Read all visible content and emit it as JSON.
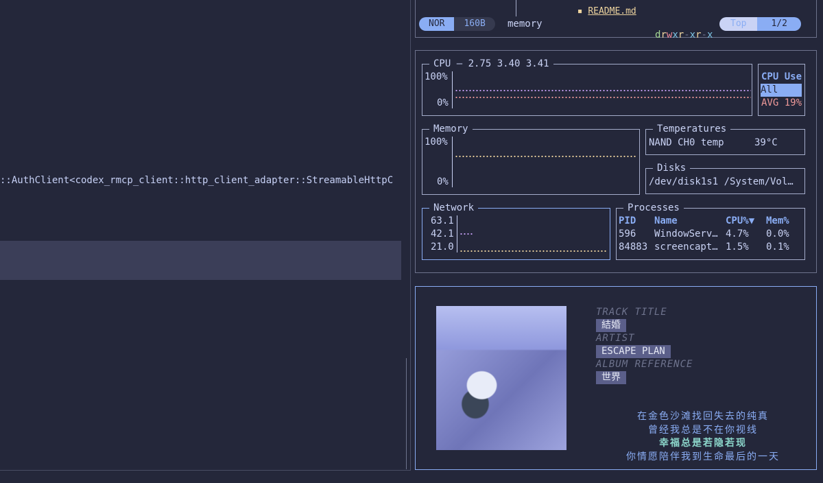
{
  "terminal": {
    "code_line": "::AuthClient<codex_rmcp_client::http_client_adapter::StreamableHttpC"
  },
  "yazi": {
    "file_name": "README.md",
    "mode": "NOR",
    "size": "160B",
    "hovered": "memory",
    "perm": {
      "d": "d",
      "r1": "r",
      "w1": "w",
      "x1": "x",
      "r2": "r",
      "d2": "-",
      "x2": "x",
      "r3": "r",
      "d3": "-",
      "x3": "x"
    },
    "position": "Top",
    "page": "1/2"
  },
  "btm": {
    "cpu": {
      "title": "CPU — 2.75 3.40 3.41",
      "y_max": "100%",
      "y_min": "0%",
      "legend_title": "CPU Use",
      "legend_all": "All",
      "legend_avg": "AVG 19%"
    },
    "memory": {
      "title": "Memory",
      "y_max": "100%",
      "y_min": "0%"
    },
    "temperatures": {
      "title": "Temperatures",
      "sensor": "NAND CH0 temp",
      "value": "39°C"
    },
    "disks": {
      "title": "Disks",
      "row": "/dev/disk1s1 /System/Vol…"
    },
    "network": {
      "title": "Network",
      "labels": [
        "63.1",
        "42.1",
        "21.0"
      ]
    },
    "processes": {
      "title": "Processes",
      "headers": [
        "PID",
        "Name",
        "CPU%▼",
        "Mem%"
      ],
      "rows": [
        [
          "596",
          "WindowServ…",
          "4.7%",
          "0.0%"
        ],
        [
          "84883",
          "screencapt…",
          "1.5%",
          "0.1%"
        ]
      ]
    }
  },
  "music": {
    "track_title_label": "TRACK TITLE",
    "track_title": "結婚",
    "artist_label": "ARTIST",
    "artist": "ESCAPE PLAN",
    "album_label": "ALBUM REFERENCE",
    "album": "世界",
    "lyrics": [
      "在金色沙滩找回失去的纯真",
      "曾经我总是不在你视线",
      "幸福总是若隐若现",
      "你情愿陪伴我到生命最后的一天"
    ]
  },
  "colors": {
    "background": "#24273a",
    "accent": "#8aadf4",
    "selection": "#3b3e58",
    "cpu_all": "#c6a0f6",
    "cpu_avg": "#ee9999"
  }
}
